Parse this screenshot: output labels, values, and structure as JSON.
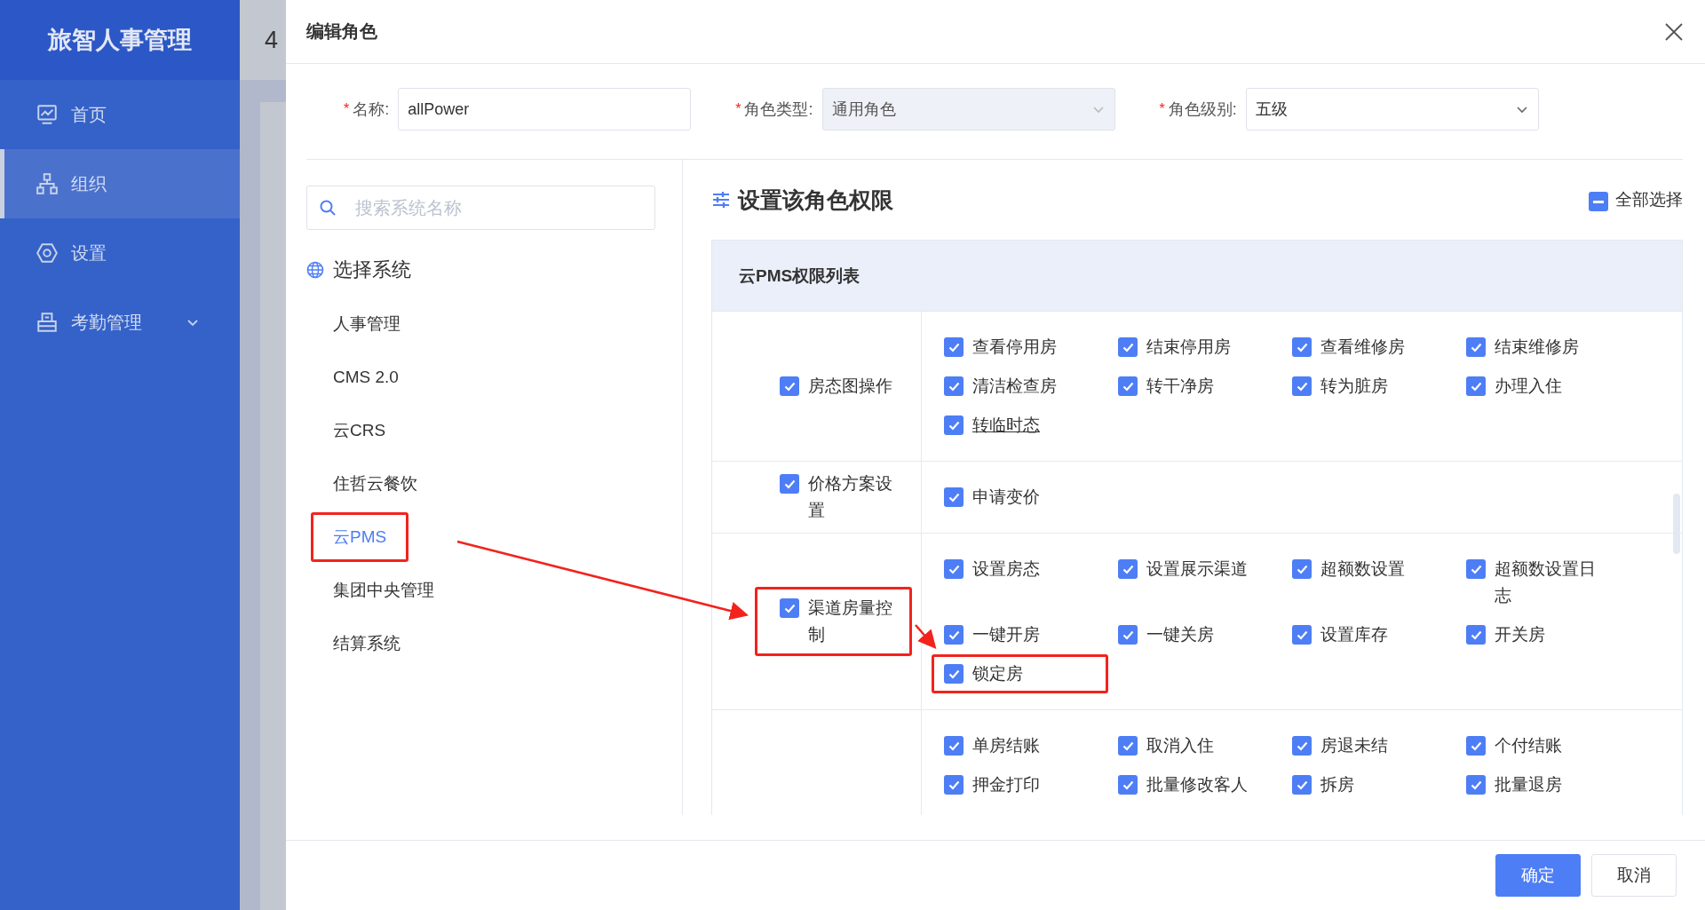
{
  "sidebar": {
    "title": "旅智人事管理",
    "items": [
      {
        "label": "首页",
        "selected": false,
        "expandable": false
      },
      {
        "label": "组织",
        "selected": true,
        "expandable": false
      },
      {
        "label": "设置",
        "selected": false,
        "expandable": false
      },
      {
        "label": "考勤管理",
        "selected": false,
        "expandable": true
      }
    ]
  },
  "backdrop": {
    "text": "4"
  },
  "dialog": {
    "title": "编辑角色",
    "fields": [
      {
        "kind": "input",
        "marker": "*",
        "label": "名称:",
        "value": "allPower",
        "disabled": false
      },
      {
        "kind": "select",
        "marker": "*",
        "label": "角色类型:",
        "value": "通用角色",
        "disabled": true
      },
      {
        "kind": "select",
        "marker": "*",
        "label": "角色级别:",
        "value": "五级",
        "disabled": false
      }
    ],
    "search": {
      "placeholder": "搜索系统名称"
    },
    "systems_title": "选择系统",
    "systems": [
      {
        "label": "人事管理",
        "selected": false,
        "highlighted": false
      },
      {
        "label": "CMS 2.0",
        "selected": false,
        "highlighted": false
      },
      {
        "label": "云CRS",
        "selected": false,
        "highlighted": false
      },
      {
        "label": "住哲云餐饮",
        "selected": false,
        "highlighted": false
      },
      {
        "label": "云PMS",
        "selected": true,
        "highlighted": true
      },
      {
        "label": "集团中央管理",
        "selected": false,
        "highlighted": false
      },
      {
        "label": "结算系统",
        "selected": false,
        "highlighted": false
      }
    ],
    "permissions_title": "设置该角色权限",
    "select_all": {
      "label": "全部选择",
      "indeterminate": true
    },
    "table_title": "云PMS权限列表",
    "groups": [
      {
        "label": "房态图操作",
        "checked": true,
        "highlighted": false,
        "items": [
          {
            "label": "查看停用房",
            "checked": true,
            "underlined": false,
            "highlighted": false
          },
          {
            "label": "结束停用房",
            "checked": true,
            "underlined": false,
            "highlighted": false
          },
          {
            "label": "查看维修房",
            "checked": true,
            "underlined": false,
            "highlighted": false
          },
          {
            "label": "结束维修房",
            "checked": true,
            "underlined": false,
            "highlighted": false
          },
          {
            "label": "清洁检查房",
            "checked": true,
            "underlined": false,
            "highlighted": false
          },
          {
            "label": "转干净房",
            "checked": true,
            "underlined": false,
            "highlighted": false
          },
          {
            "label": "转为脏房",
            "checked": true,
            "underlined": false,
            "highlighted": false
          },
          {
            "label": "办理入住",
            "checked": true,
            "underlined": false,
            "highlighted": false
          },
          {
            "label": "转临时态",
            "checked": true,
            "underlined": true,
            "highlighted": false
          }
        ]
      },
      {
        "label": "价格方案设置",
        "checked": true,
        "highlighted": false,
        "items": [
          {
            "label": "申请变价",
            "checked": true,
            "underlined": false,
            "highlighted": false
          }
        ]
      },
      {
        "label": "渠道房量控制",
        "checked": true,
        "highlighted": true,
        "items": [
          {
            "label": "设置房态",
            "checked": true,
            "underlined": false,
            "highlighted": false
          },
          {
            "label": "设置展示渠道",
            "checked": true,
            "underlined": false,
            "highlighted": false
          },
          {
            "label": "超额数设置",
            "checked": true,
            "underlined": false,
            "highlighted": false
          },
          {
            "label": "超额数设置日志",
            "checked": true,
            "underlined": false,
            "highlighted": false
          },
          {
            "label": "一键开房",
            "checked": true,
            "underlined": false,
            "highlighted": false
          },
          {
            "label": "一键关房",
            "checked": true,
            "underlined": false,
            "highlighted": false
          },
          {
            "label": "设置库存",
            "checked": true,
            "underlined": false,
            "highlighted": false
          },
          {
            "label": "开关房",
            "checked": true,
            "underlined": false,
            "highlighted": false
          },
          {
            "label": "锁定房",
            "checked": true,
            "underlined": false,
            "highlighted": true
          }
        ]
      },
      {
        "items": [
          {
            "label": "单房结账",
            "checked": true,
            "underlined": false,
            "highlighted": false
          },
          {
            "label": "取消入住",
            "checked": true,
            "underlined": false,
            "highlighted": false
          },
          {
            "label": "房退未结",
            "checked": true,
            "underlined": false,
            "highlighted": false
          },
          {
            "label": "个付结账",
            "checked": true,
            "underlined": false,
            "highlighted": false
          },
          {
            "label": "押金打印",
            "checked": true,
            "underlined": false,
            "highlighted": false
          },
          {
            "label": "批量修改客人",
            "checked": true,
            "underlined": false,
            "highlighted": false
          },
          {
            "label": "拆房",
            "checked": true,
            "underlined": false,
            "highlighted": false
          },
          {
            "label": "批量退房",
            "checked": true,
            "underlined": false,
            "highlighted": false
          }
        ]
      }
    ],
    "buttons": [
      {
        "label": "确定",
        "kind": "primary"
      },
      {
        "label": "取消",
        "kind": "default"
      }
    ]
  }
}
